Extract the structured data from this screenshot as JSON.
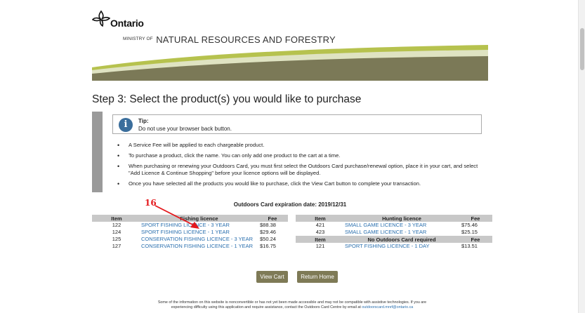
{
  "header": {
    "logo_text": "Ontario",
    "ministry_prefix": "MINISTRY OF",
    "ministry_name": "NATURAL RESOURCES AND FORESTRY"
  },
  "page_title": "Step 3: Select the product(s) you would like to purchase",
  "tip": {
    "label": "Tip:",
    "text": "Do not use your browser back button."
  },
  "instructions": [
    "A Service Fee will be applied to each chargeable product.",
    "To purchase a product, click the name. You can only add one product to the cart at a time.",
    "When purchasing or renewing your Outdoors Card, you must first select the Outdoors Card purchase/renewal option, place it in your cart, and select \"Add Licence & Continue Shopping\" before your licence options will be displayed.",
    "Once you have selected all the products you would like to purchase, click the View Cart button to complete your transaction."
  ],
  "expiration": "Outdoors Card expiration date: 2019/12/31",
  "fishing_table": {
    "headers": [
      "Item",
      "Fishing licence",
      "Fee"
    ],
    "rows": [
      {
        "item": "122",
        "name": "SPORT FISHING LICENCE - 3 YEAR",
        "fee": "$88.38"
      },
      {
        "item": "124",
        "name": "SPORT FISHING LICENCE - 1 YEAR",
        "fee": "$29.46"
      },
      {
        "item": "125",
        "name": "CONSERVATION FISHING LICENCE - 3 YEAR",
        "fee": "$50.24"
      },
      {
        "item": "127",
        "name": "CONSERVATION FISHING LICENCE - 1 YEAR",
        "fee": "$16.75"
      }
    ]
  },
  "hunting_table": {
    "headers": [
      "Item",
      "Hunting licence",
      "Fee"
    ],
    "rows": [
      {
        "item": "421",
        "name": "SMALL GAME LICENCE - 3 YEAR",
        "fee": "$75.46"
      },
      {
        "item": "423",
        "name": "SMALL GAME LICENCE - 1 YEAR",
        "fee": "$25.15"
      }
    ],
    "sub_headers": [
      "Item",
      "No Outdoors Card required",
      "Fee"
    ],
    "sub_rows": [
      {
        "item": "121",
        "name": "SPORT FISHING LICENCE - 1 DAY",
        "fee": "$13.51"
      }
    ]
  },
  "annotation": {
    "number": "16",
    "color": "#e4181c"
  },
  "buttons": {
    "view_cart": "View Cart",
    "return_home": "Return Home"
  },
  "footer": {
    "text": "Some of the information on this website is nonconvertible or has not yet been made accessible and may not be compatible with assistive technologies. If you are experiencing difficulty using this application and require assistance, contact the Outdoors Card Centre by email at",
    "email": "outdoorscard.mnrf@ontario.ca"
  },
  "colors": {
    "link": "#2a6fae",
    "button": "#7e7a56",
    "table_header": "#c8c8c8",
    "band_dark": "#7b7957",
    "band_light": "#b6c24e"
  }
}
